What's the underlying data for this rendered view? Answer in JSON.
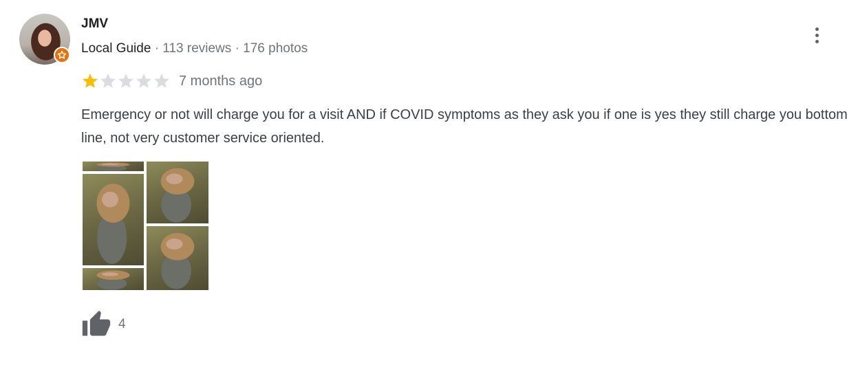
{
  "reviewer": {
    "name": "JMV",
    "badge": "Local Guide",
    "separator": "·",
    "reviews": "113 reviews",
    "photos": "176 photos"
  },
  "review": {
    "rating": 1,
    "max_rating": 5,
    "date": "7 months ago",
    "text": "Emergency or not will charge you for a visit AND if COVID symptoms as they ask you if one is yes they still charge you bottom line, not very customer service oriented."
  },
  "likes": {
    "count": "4"
  },
  "colors": {
    "star_filled": "#fbbc04",
    "star_empty": "#dadce0",
    "guide_badge": "#e8710a",
    "thumb": "#5f6368"
  },
  "icons": {
    "more": "more-vert-icon",
    "like": "thumb-up-icon",
    "badge": "local-guide-star-icon"
  }
}
